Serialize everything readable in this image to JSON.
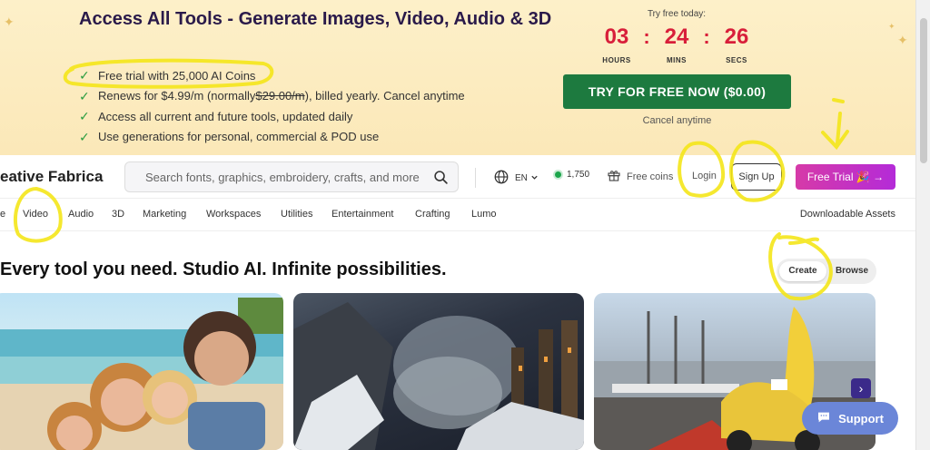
{
  "banner": {
    "title": "Access All Tools - Generate Images, Video, Audio & 3D",
    "perks": [
      {
        "prefix": "Free trial with 25,000 AI Coins",
        "strike": "",
        "suffix": ""
      },
      {
        "prefix": "Renews for $4.99/m (normally ",
        "strike": "$29.00/m",
        "suffix": "), billed yearly. Cancel anytime"
      },
      {
        "prefix": "Access all current and future tools, updated daily",
        "strike": "",
        "suffix": ""
      },
      {
        "prefix": "Use generations for personal, commercial & POD use",
        "strike": "",
        "suffix": ""
      }
    ],
    "countdown": {
      "label": "Try free today:",
      "hours": "03",
      "mins": "24",
      "secs": "26",
      "hours_label": "HOURS",
      "mins_label": "MINS",
      "secs_label": "SECS"
    },
    "cta_label": "TRY FOR FREE NOW ($0.00)",
    "cancel_text": "Cancel anytime"
  },
  "header": {
    "logo": "eative Fabrica",
    "search_placeholder": "Search fonts, graphics, embroidery, crafts, and more",
    "language": "EN",
    "coin_balance": "1,750",
    "free_coins_label": "Free coins",
    "login_label": "Login",
    "signup_label": "Sign Up",
    "free_trial_label": "Free Trial 🎉 →"
  },
  "nav": {
    "items": [
      "e",
      "Video",
      "Audio",
      "3D",
      "Marketing",
      "Workspaces",
      "Utilities",
      "Entertainment",
      "Crafting",
      "Lumo"
    ],
    "right": "Downloadable Assets"
  },
  "main": {
    "headline": "Every tool you need. Studio AI. Infinite possibilities.",
    "toggle": {
      "create": "Create",
      "browse": "Browse"
    },
    "support_label": "Support"
  },
  "colors": {
    "banner_bg": "#fbe8b8",
    "accent_red": "#d81f3a",
    "cta_green": "#1d7a3f",
    "free_trial_pink": "#d63aa8",
    "support_blue": "#6b86d8",
    "annotation_yellow": "#f4e61a"
  }
}
